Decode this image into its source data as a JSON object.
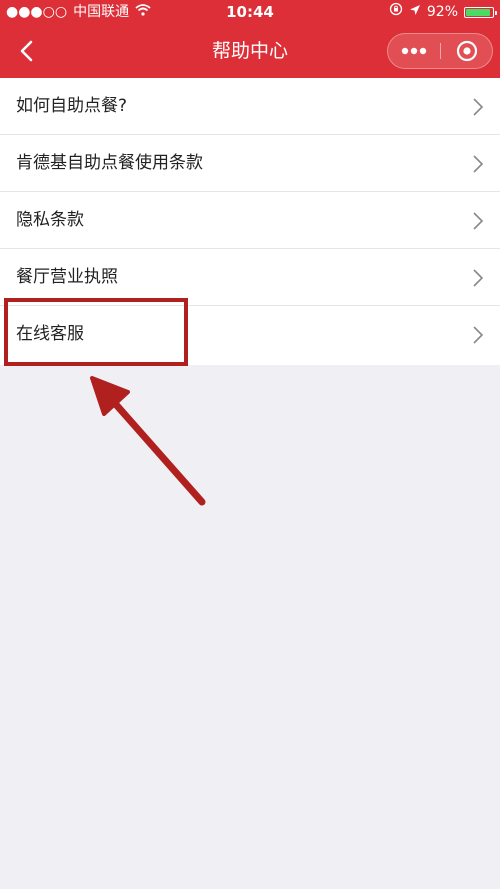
{
  "status_bar": {
    "signal": "●●●○○",
    "carrier": "中国联通",
    "time": "10:44",
    "battery_percent": "92%",
    "battery_level": 0.92
  },
  "nav": {
    "title": "帮助中心"
  },
  "menu": {
    "items": [
      {
        "label": "如何自助点餐?"
      },
      {
        "label": "肯德基自助点餐使用条款"
      },
      {
        "label": "隐私条款"
      },
      {
        "label": "餐厅营业执照"
      },
      {
        "label": "在线客服"
      }
    ]
  },
  "colors": {
    "header_bg": "#dc2f37",
    "page_bg": "#efeff4",
    "annotation": "#b0201f"
  }
}
